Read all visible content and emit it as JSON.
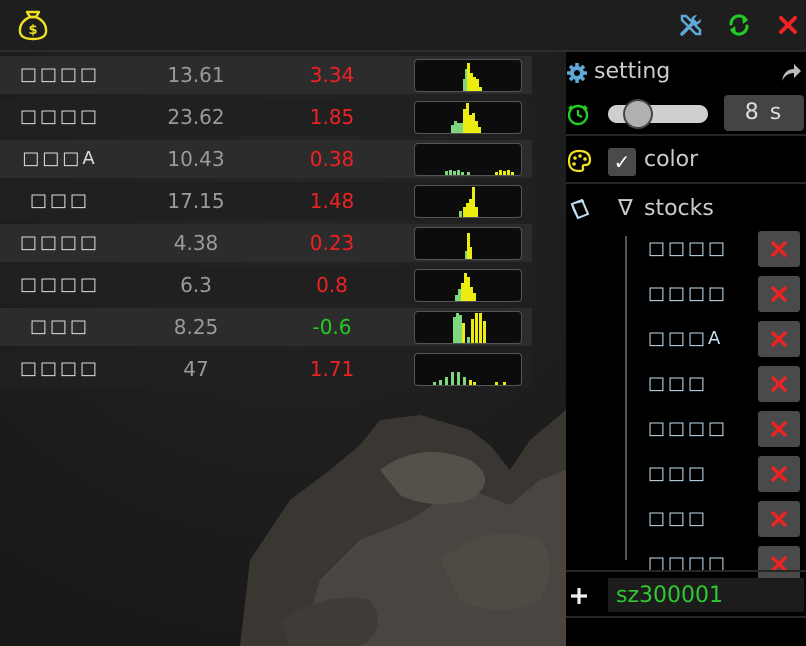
{
  "toolbar": {
    "icons": [
      "money-bag-icon",
      "tools-icon",
      "refresh-icon",
      "close-icon"
    ],
    "colors": {
      "logo": "#f0e020",
      "tools": "#5fa8d8",
      "refresh": "#22cc22",
      "close": "#ee2222"
    }
  },
  "stocks": [
    {
      "name": "□□□□",
      "price": "13.61",
      "change": "3.34",
      "direction": "up"
    },
    {
      "name": "□□□□",
      "price": "23.62",
      "change": "1.85",
      "direction": "up"
    },
    {
      "name": "□□□A",
      "price": "10.43",
      "change": "0.38",
      "direction": "up"
    },
    {
      "name": "□□□",
      "price": "17.15",
      "change": "1.48",
      "direction": "up"
    },
    {
      "name": "□□□□",
      "price": "4.38",
      "change": "0.23",
      "direction": "up"
    },
    {
      "name": "□□□□",
      "price": "6.3",
      "change": "0.8",
      "direction": "up"
    },
    {
      "name": "□□□",
      "price": "8.25",
      "change": "-0.6",
      "direction": "down"
    },
    {
      "name": "□□□□",
      "price": "47",
      "change": "1.71",
      "direction": "up"
    }
  ],
  "colors": {
    "up": "#ee2222",
    "down": "#22cc22",
    "spark_green": "#7ed67e",
    "spark_yellow": "#ecec10"
  },
  "settings": {
    "title": "setting",
    "interval_value": "8",
    "interval_unit": "s",
    "interval_display": "8 s",
    "color_label": "color",
    "color_checked": true,
    "checkmark": "✓",
    "stocks_label": "stocks",
    "stocks_expander": "∇"
  },
  "panel_stock_list": [
    "□□□□",
    "□□□□",
    "□□□A",
    "□□□",
    "□□□□",
    "□□□",
    "□□□",
    "□□□□"
  ],
  "add": {
    "plus": "+",
    "input_value": "sz300001"
  }
}
